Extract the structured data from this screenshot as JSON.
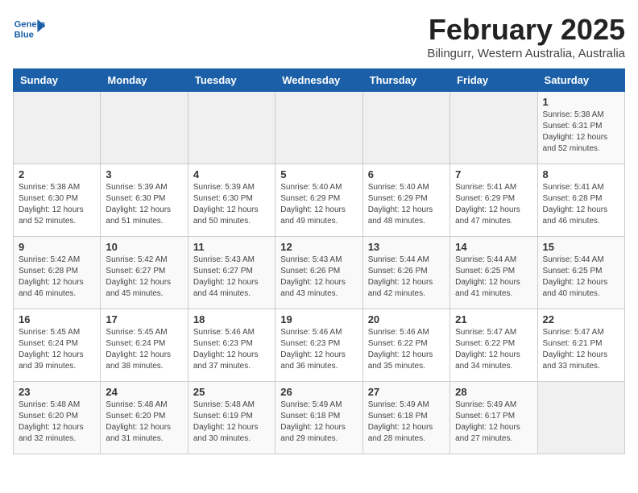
{
  "header": {
    "logo_line1": "General",
    "logo_line2": "Blue",
    "month": "February 2025",
    "location": "Bilingurr, Western Australia, Australia"
  },
  "weekdays": [
    "Sunday",
    "Monday",
    "Tuesday",
    "Wednesday",
    "Thursday",
    "Friday",
    "Saturday"
  ],
  "weeks": [
    [
      {
        "day": "",
        "info": ""
      },
      {
        "day": "",
        "info": ""
      },
      {
        "day": "",
        "info": ""
      },
      {
        "day": "",
        "info": ""
      },
      {
        "day": "",
        "info": ""
      },
      {
        "day": "",
        "info": ""
      },
      {
        "day": "1",
        "info": "Sunrise: 5:38 AM\nSunset: 6:31 PM\nDaylight: 12 hours and 52 minutes."
      }
    ],
    [
      {
        "day": "2",
        "info": "Sunrise: 5:38 AM\nSunset: 6:30 PM\nDaylight: 12 hours and 52 minutes."
      },
      {
        "day": "3",
        "info": "Sunrise: 5:39 AM\nSunset: 6:30 PM\nDaylight: 12 hours and 51 minutes."
      },
      {
        "day": "4",
        "info": "Sunrise: 5:39 AM\nSunset: 6:30 PM\nDaylight: 12 hours and 50 minutes."
      },
      {
        "day": "5",
        "info": "Sunrise: 5:40 AM\nSunset: 6:29 PM\nDaylight: 12 hours and 49 minutes."
      },
      {
        "day": "6",
        "info": "Sunrise: 5:40 AM\nSunset: 6:29 PM\nDaylight: 12 hours and 48 minutes."
      },
      {
        "day": "7",
        "info": "Sunrise: 5:41 AM\nSunset: 6:29 PM\nDaylight: 12 hours and 47 minutes."
      },
      {
        "day": "8",
        "info": "Sunrise: 5:41 AM\nSunset: 6:28 PM\nDaylight: 12 hours and 46 minutes."
      }
    ],
    [
      {
        "day": "9",
        "info": "Sunrise: 5:42 AM\nSunset: 6:28 PM\nDaylight: 12 hours and 46 minutes."
      },
      {
        "day": "10",
        "info": "Sunrise: 5:42 AM\nSunset: 6:27 PM\nDaylight: 12 hours and 45 minutes."
      },
      {
        "day": "11",
        "info": "Sunrise: 5:43 AM\nSunset: 6:27 PM\nDaylight: 12 hours and 44 minutes."
      },
      {
        "day": "12",
        "info": "Sunrise: 5:43 AM\nSunset: 6:26 PM\nDaylight: 12 hours and 43 minutes."
      },
      {
        "day": "13",
        "info": "Sunrise: 5:44 AM\nSunset: 6:26 PM\nDaylight: 12 hours and 42 minutes."
      },
      {
        "day": "14",
        "info": "Sunrise: 5:44 AM\nSunset: 6:25 PM\nDaylight: 12 hours and 41 minutes."
      },
      {
        "day": "15",
        "info": "Sunrise: 5:44 AM\nSunset: 6:25 PM\nDaylight: 12 hours and 40 minutes."
      }
    ],
    [
      {
        "day": "16",
        "info": "Sunrise: 5:45 AM\nSunset: 6:24 PM\nDaylight: 12 hours and 39 minutes."
      },
      {
        "day": "17",
        "info": "Sunrise: 5:45 AM\nSunset: 6:24 PM\nDaylight: 12 hours and 38 minutes."
      },
      {
        "day": "18",
        "info": "Sunrise: 5:46 AM\nSunset: 6:23 PM\nDaylight: 12 hours and 37 minutes."
      },
      {
        "day": "19",
        "info": "Sunrise: 5:46 AM\nSunset: 6:23 PM\nDaylight: 12 hours and 36 minutes."
      },
      {
        "day": "20",
        "info": "Sunrise: 5:46 AM\nSunset: 6:22 PM\nDaylight: 12 hours and 35 minutes."
      },
      {
        "day": "21",
        "info": "Sunrise: 5:47 AM\nSunset: 6:22 PM\nDaylight: 12 hours and 34 minutes."
      },
      {
        "day": "22",
        "info": "Sunrise: 5:47 AM\nSunset: 6:21 PM\nDaylight: 12 hours and 33 minutes."
      }
    ],
    [
      {
        "day": "23",
        "info": "Sunrise: 5:48 AM\nSunset: 6:20 PM\nDaylight: 12 hours and 32 minutes."
      },
      {
        "day": "24",
        "info": "Sunrise: 5:48 AM\nSunset: 6:20 PM\nDaylight: 12 hours and 31 minutes."
      },
      {
        "day": "25",
        "info": "Sunrise: 5:48 AM\nSunset: 6:19 PM\nDaylight: 12 hours and 30 minutes."
      },
      {
        "day": "26",
        "info": "Sunrise: 5:49 AM\nSunset: 6:18 PM\nDaylight: 12 hours and 29 minutes."
      },
      {
        "day": "27",
        "info": "Sunrise: 5:49 AM\nSunset: 6:18 PM\nDaylight: 12 hours and 28 minutes."
      },
      {
        "day": "28",
        "info": "Sunrise: 5:49 AM\nSunset: 6:17 PM\nDaylight: 12 hours and 27 minutes."
      },
      {
        "day": "",
        "info": ""
      }
    ]
  ]
}
